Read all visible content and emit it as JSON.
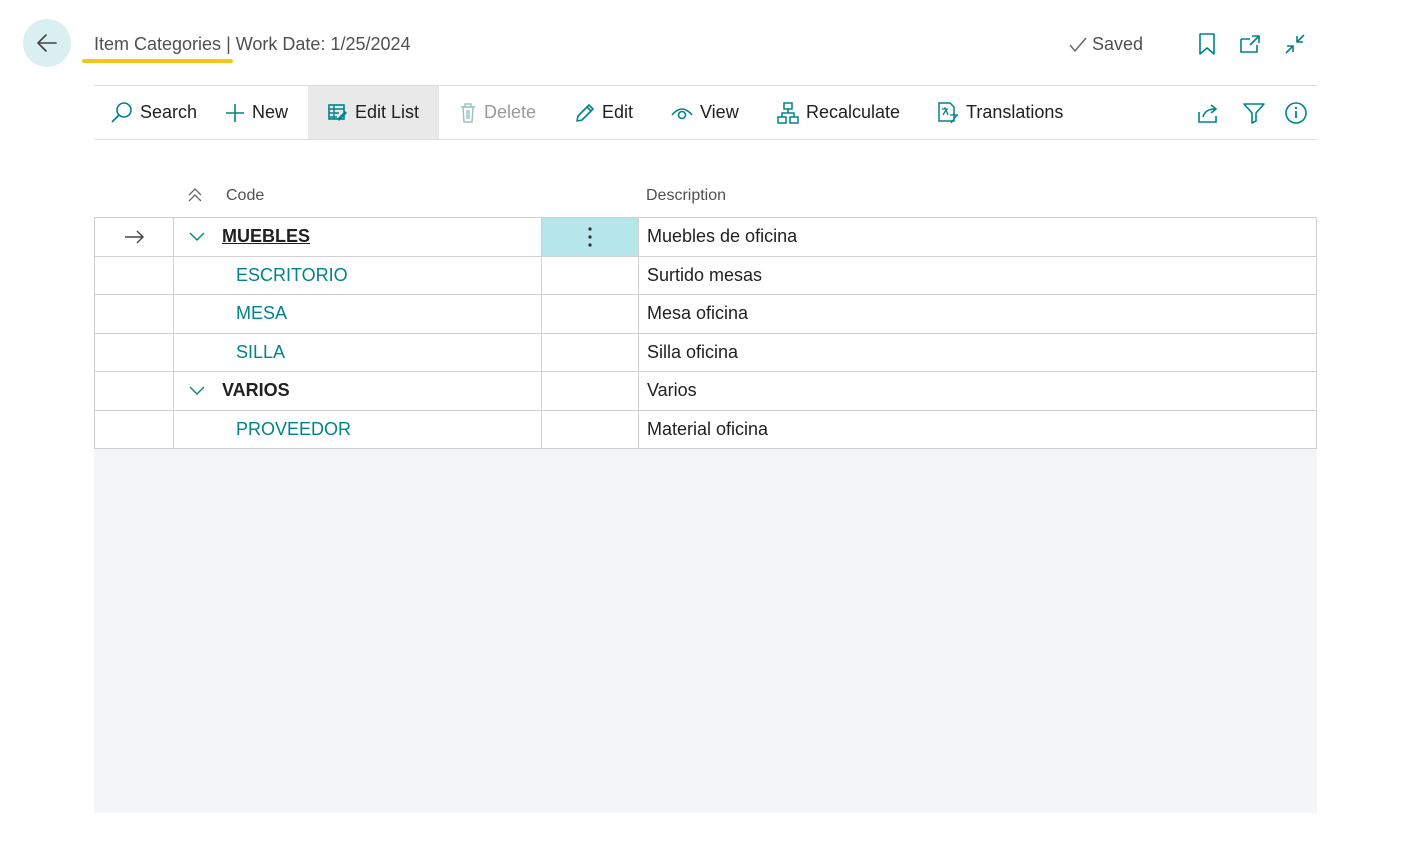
{
  "header": {
    "title": "Item Categories",
    "separator": " | ",
    "work_date": "Work Date: 1/25/2024",
    "saved_label": "Saved",
    "accent_color": "#f7c519"
  },
  "icons": {
    "back": "arrow-left-icon",
    "bookmark": "bookmark-icon",
    "open_new_window": "open-new-window-icon",
    "collapse": "collapse-icon",
    "share": "share-icon",
    "filter": "filter-icon",
    "info": "info-icon"
  },
  "toolbar": {
    "search": "Search",
    "new": "New",
    "edit_list": "Edit List",
    "delete": "Delete",
    "edit": "Edit",
    "view": "View",
    "recalculate": "Recalculate",
    "translations": "Translations"
  },
  "table": {
    "columns": {
      "code": "Code",
      "description": "Description"
    },
    "rows": [
      {
        "code": "MUEBLES",
        "description": "Muebles de oficina",
        "level": 0,
        "expanded": true,
        "selected": true
      },
      {
        "code": "ESCRITORIO",
        "description": "Surtido mesas",
        "level": 1
      },
      {
        "code": "MESA",
        "description": "Mesa oficina",
        "level": 1
      },
      {
        "code": "SILLA",
        "description": "Silla oficina",
        "level": 1
      },
      {
        "code": "VARIOS",
        "description": "Varios",
        "level": 0,
        "expanded": true
      },
      {
        "code": "PROVEEDOR",
        "description": "Material oficina",
        "level": 1
      }
    ],
    "link_color": "#00838a",
    "selected_menu_color": "#b4e6ea"
  }
}
